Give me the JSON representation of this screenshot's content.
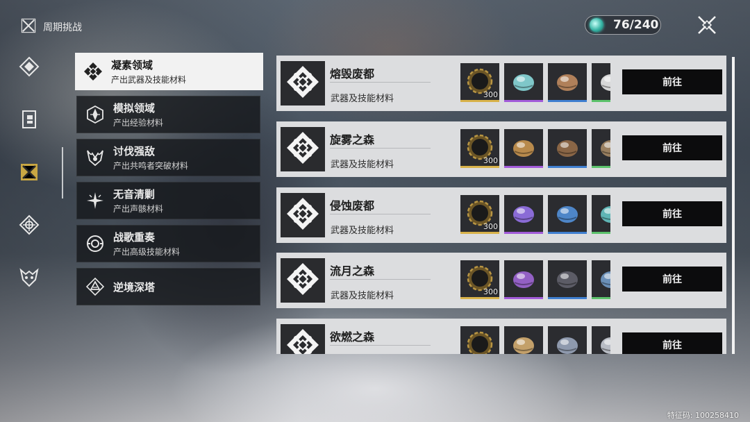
{
  "header": {
    "title": "周期挑战",
    "title_icon": "crossed-blades-icon",
    "currency_value": "76/240",
    "currency_icon": "waveplate-orb-icon",
    "close_icon": "close-x-icon"
  },
  "side_rail": [
    {
      "icon": "compass-diamond-icon",
      "active": false
    },
    {
      "icon": "door-book-icon",
      "active": false
    },
    {
      "icon": "crossed-blades-icon",
      "active": true
    },
    {
      "icon": "gear-flower-icon",
      "active": false
    },
    {
      "icon": "demon-mask-icon",
      "active": false
    }
  ],
  "categories": [
    {
      "name": "凝素领域",
      "subtitle": "产出武器及技能材料",
      "icon": "crossed-swords-diamond-icon",
      "active": true
    },
    {
      "name": "模拟领域",
      "subtitle": "产出经验材料",
      "icon": "hex-star-icon",
      "active": false
    },
    {
      "name": "讨伐强敌",
      "subtitle": "产出共鸣者突破材料",
      "icon": "horned-crest-icon",
      "active": false
    },
    {
      "name": "无音清剿",
      "subtitle": "产出声骸材料",
      "icon": "spark-star-icon",
      "active": false
    },
    {
      "name": "战歌重奏",
      "subtitle": "产出高级技能材料",
      "icon": "ring-emblem-icon",
      "active": false
    },
    {
      "name": "逆境深塔",
      "subtitle": "",
      "icon": "triangle-tower-icon",
      "active": false
    }
  ],
  "domains": [
    {
      "name": "熔毁废都",
      "subtitle": "武器及技能材料",
      "qty": "300",
      "go_label": "前往",
      "rewards": [
        {
          "icon": "shell-credit-icon",
          "quality": "#d8b24a"
        },
        {
          "icon": "iridescent-shell-icon",
          "quality": "#a25bd9"
        },
        {
          "icon": "copper-shell-icon",
          "quality": "#3f7fd0"
        },
        {
          "icon": "white-shell-icon",
          "quality": "#5cc26b"
        }
      ]
    },
    {
      "name": "旋雾之森",
      "subtitle": "武器及技能材料",
      "qty": "300",
      "go_label": "前往",
      "rewards": [
        {
          "icon": "shell-credit-icon",
          "quality": "#d8b24a"
        },
        {
          "icon": "spiral-gold-icon",
          "quality": "#a25bd9"
        },
        {
          "icon": "spiral-bronze-icon",
          "quality": "#3f7fd0"
        },
        {
          "icon": "spiral-plain-icon",
          "quality": "#5cc26b"
        }
      ]
    },
    {
      "name": "侵蚀废都",
      "subtitle": "武器及技能材料",
      "qty": "300",
      "go_label": "前往",
      "rewards": [
        {
          "icon": "shell-credit-icon",
          "quality": "#d8b24a"
        },
        {
          "icon": "violet-orb-icon",
          "quality": "#a25bd9"
        },
        {
          "icon": "blue-orb-icon",
          "quality": "#3f7fd0"
        },
        {
          "icon": "teal-orb-icon",
          "quality": "#5cc26b"
        }
      ]
    },
    {
      "name": "流月之森",
      "subtitle": "武器及技能材料",
      "qty": "300",
      "go_label": "前往",
      "rewards": [
        {
          "icon": "shell-credit-icon",
          "quality": "#d8b24a"
        },
        {
          "icon": "purple-flame-icon",
          "quality": "#a25bd9"
        },
        {
          "icon": "dark-flame-icon",
          "quality": "#3f7fd0"
        },
        {
          "icon": "blue-flame-icon",
          "quality": "#5cc26b"
        }
      ]
    },
    {
      "name": "欲燃之森",
      "subtitle": "",
      "qty": "",
      "go_label": "前往",
      "rewards": [
        {
          "icon": "shell-credit-icon",
          "quality": "#d8b24a"
        },
        {
          "icon": "amber-crystal-icon",
          "quality": "#a25bd9"
        },
        {
          "icon": "silver-crystal-icon",
          "quality": "#3f7fd0"
        },
        {
          "icon": "pale-crystal-icon",
          "quality": "#5cc26b"
        }
      ]
    }
  ],
  "footer": {
    "id_text": "特征码: 100258410"
  }
}
